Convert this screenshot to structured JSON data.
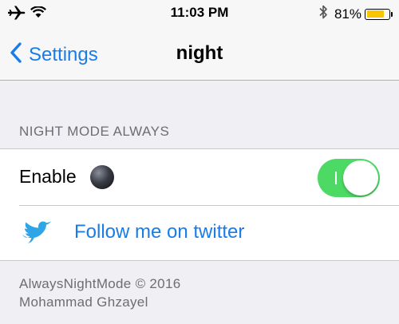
{
  "status_bar": {
    "time": "11:03 PM",
    "battery_percent": "81%",
    "battery_level": 0.81,
    "icons": [
      "airplane-icon",
      "wifi-icon",
      "bluetooth-icon",
      "battery-icon"
    ]
  },
  "nav": {
    "back_label": "Settings",
    "title": "night"
  },
  "section": {
    "header": "NIGHT MODE ALWAYS",
    "rows": {
      "enable": {
        "label": "Enable",
        "icon": "moon-ball-icon",
        "toggle_on": true
      },
      "twitter": {
        "icon": "twitter-bird-icon",
        "label": "Follow me on twitter"
      }
    }
  },
  "footer": {
    "line1": "AlwaysNightMode © 2016",
    "line2": "Mohammad Ghzayel"
  },
  "colors": {
    "accent": "#1a7ce6",
    "toggle_on": "#4cd964",
    "battery": "#f7c600",
    "background": "#efeff4"
  }
}
